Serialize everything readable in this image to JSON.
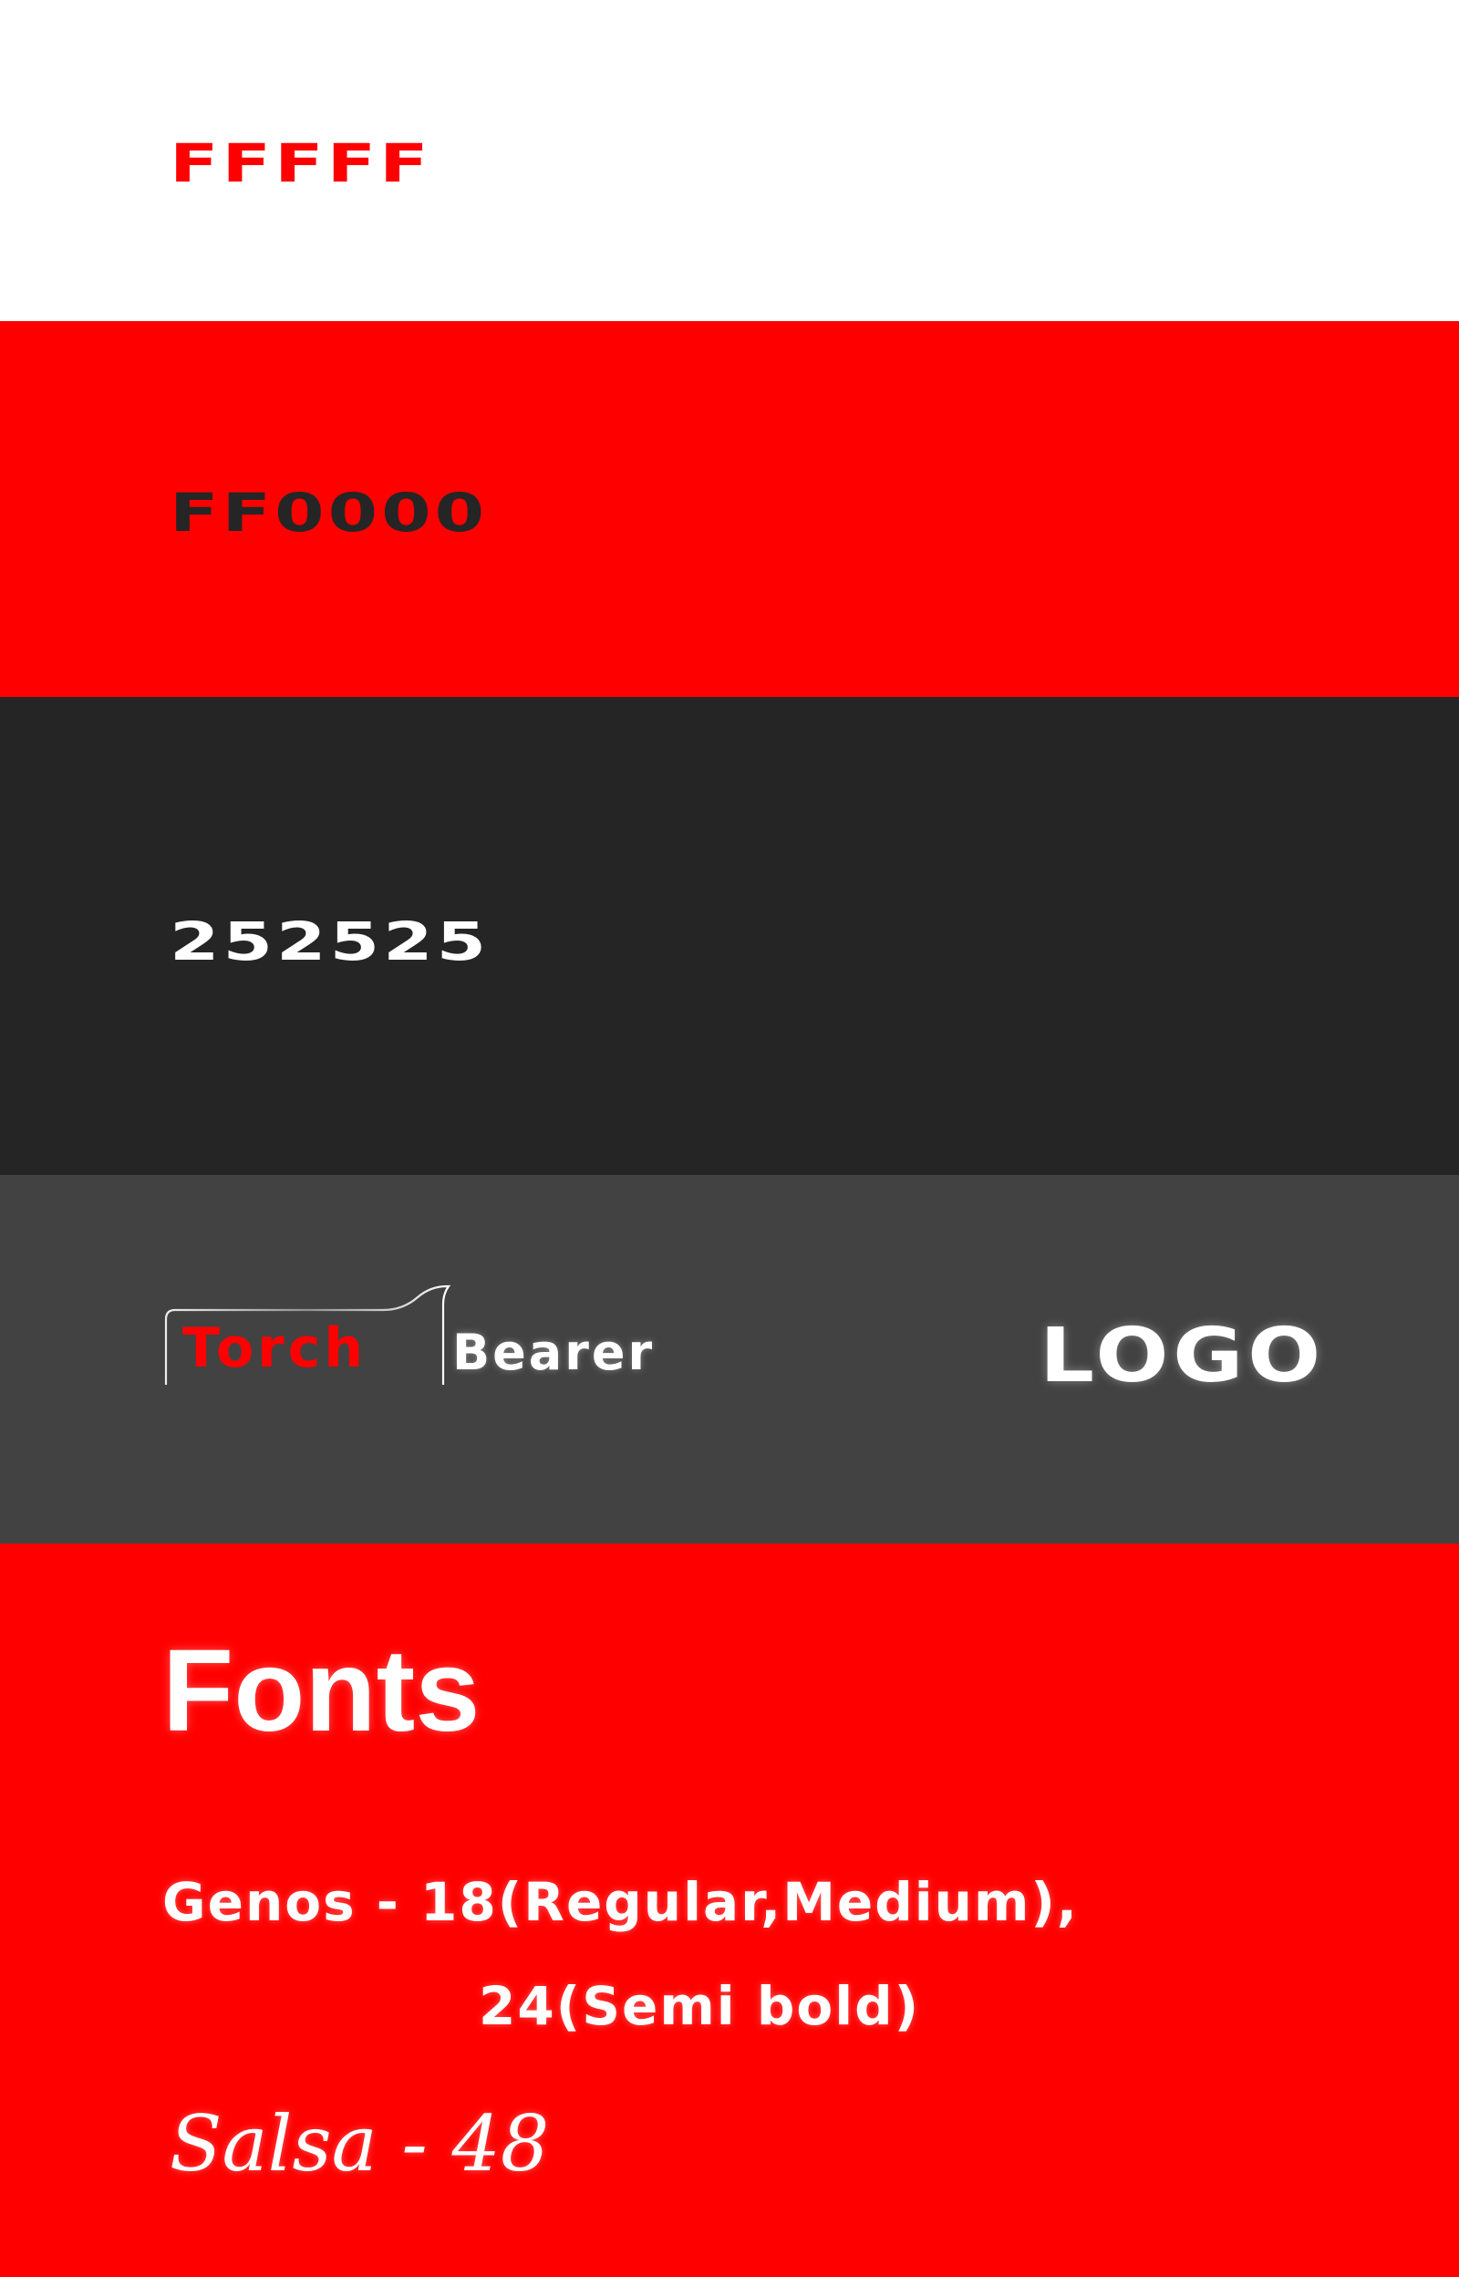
{
  "swatches": [
    {
      "label": "FFFFF",
      "background": "#ffffff",
      "text_color": "#ff0000"
    },
    {
      "label": "FF0000",
      "background": "#ff0000",
      "text_color": "#252525"
    },
    {
      "label": "252525",
      "background": "#252525",
      "text_color": "#ffffff"
    }
  ],
  "logo": {
    "background": "#424242",
    "torch_text": "Torch",
    "bearer_text": "Bearer",
    "torch_color": "#ff0000",
    "bearer_color": "#ffffff",
    "logo_word": "LOGO"
  },
  "fonts": {
    "background": "#ff0000",
    "title": "Fonts",
    "genos_line_1": "Genos - 18(Regular,Medium),",
    "genos_line_2": "24(Semi bold)",
    "salsa_line": "Salsa - 48"
  }
}
